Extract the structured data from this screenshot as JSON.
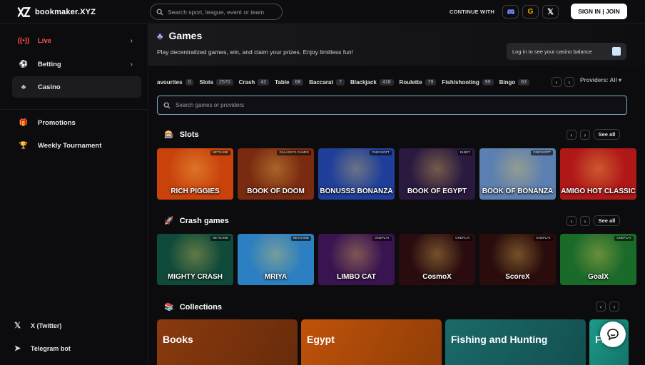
{
  "header": {
    "brand": "bookmaker.XYZ",
    "search_placeholder": "Search sport, league, event or team",
    "continue_with": "CONTINUE WITH",
    "social": [
      "discord-icon",
      "google-icon",
      "x-icon"
    ],
    "signin_label": "SIGN IN | JOIN"
  },
  "sidebar": {
    "items": [
      {
        "label": "Live",
        "icon": "live-icon",
        "chevron": true
      },
      {
        "label": "Betting",
        "icon": "soccer-ball-icon",
        "chevron": true
      },
      {
        "label": "Casino",
        "icon": "club-icon",
        "chevron": false
      }
    ],
    "secondary": [
      {
        "label": "Promotions",
        "icon": "gift-icon"
      },
      {
        "label": "Weekly Tournament",
        "icon": "trophy-icon"
      }
    ],
    "footer": [
      {
        "label": "X (Twitter)",
        "icon": "x-icon"
      },
      {
        "label": "Telegram bot",
        "icon": "telegram-icon"
      }
    ]
  },
  "games": {
    "title": "Games",
    "subtitle": "Play decentralized games, win, and claim your prizes. Enjoy limitless fun!",
    "casino_balance": "Log in to see your casino balance",
    "categories": [
      {
        "label": "avourites",
        "count": "0"
      },
      {
        "label": "Slots",
        "count": "2570"
      },
      {
        "label": "Crash",
        "count": "42"
      },
      {
        "label": "Table",
        "count": "68"
      },
      {
        "label": "Baccarat",
        "count": "7"
      },
      {
        "label": "Blackjack",
        "count": "418"
      },
      {
        "label": "Roulette",
        "count": "79"
      },
      {
        "label": "Fish/shooting",
        "count": "99"
      },
      {
        "label": "Bingo",
        "count": "63"
      }
    ],
    "providers_label": "Providers: All ▾",
    "search_placeholder": "Search games or providers"
  },
  "slots": {
    "title": "Slots",
    "see_all": "See all",
    "items": [
      {
        "name": "RICH PIGGIES",
        "provider": "NETGAME",
        "bg": "#c9420c"
      },
      {
        "name": "BOOK OF DOOM",
        "provider": "GALAXSYS GAMES",
        "bg": "#7a2a10"
      },
      {
        "name": "BONUSSS BONANZA",
        "provider": "ONEXSOFT",
        "bg": "#1f3f9a"
      },
      {
        "name": "BOOK OF EGYPT",
        "provider": "ELBET",
        "bg": "#2a1a40"
      },
      {
        "name": "BOOK OF BONANZA",
        "provider": "ONEXSOFT",
        "bg": "#5b7fb0"
      },
      {
        "name": "AMIGO HOT CLASSIC",
        "provider": "",
        "bg": "#b01818"
      }
    ]
  },
  "crash": {
    "title": "Crash games",
    "see_all": "See all",
    "items": [
      {
        "name": "MIGHTY CRASH",
        "provider": "NETGAME",
        "bg": "#0f4a3a"
      },
      {
        "name": "MRIYA",
        "provider": "NETGAME",
        "bg": "#2c7fc0"
      },
      {
        "name": "LIMBO CAT",
        "provider": "ONEPLAY",
        "bg": "#3a1450"
      },
      {
        "name": "CosmoX",
        "provider": "ONEPLAY",
        "bg": "#2a0c10"
      },
      {
        "name": "ScoreX",
        "provider": "ONEPLAY",
        "bg": "#2a0c0c"
      },
      {
        "name": "GoalX",
        "provider": "ONEPLAY",
        "bg": "#1a6a2a"
      }
    ]
  },
  "collections": {
    "title": "Collections",
    "items": [
      {
        "name": "Books",
        "bg": "#8a3a0e"
      },
      {
        "name": "Egypt",
        "bg": "#c0520a"
      },
      {
        "name": "Fishing and Hunting",
        "bg": "#1a6a6a"
      },
      {
        "name": "Fr",
        "bg": "#1a9a8a"
      }
    ]
  }
}
